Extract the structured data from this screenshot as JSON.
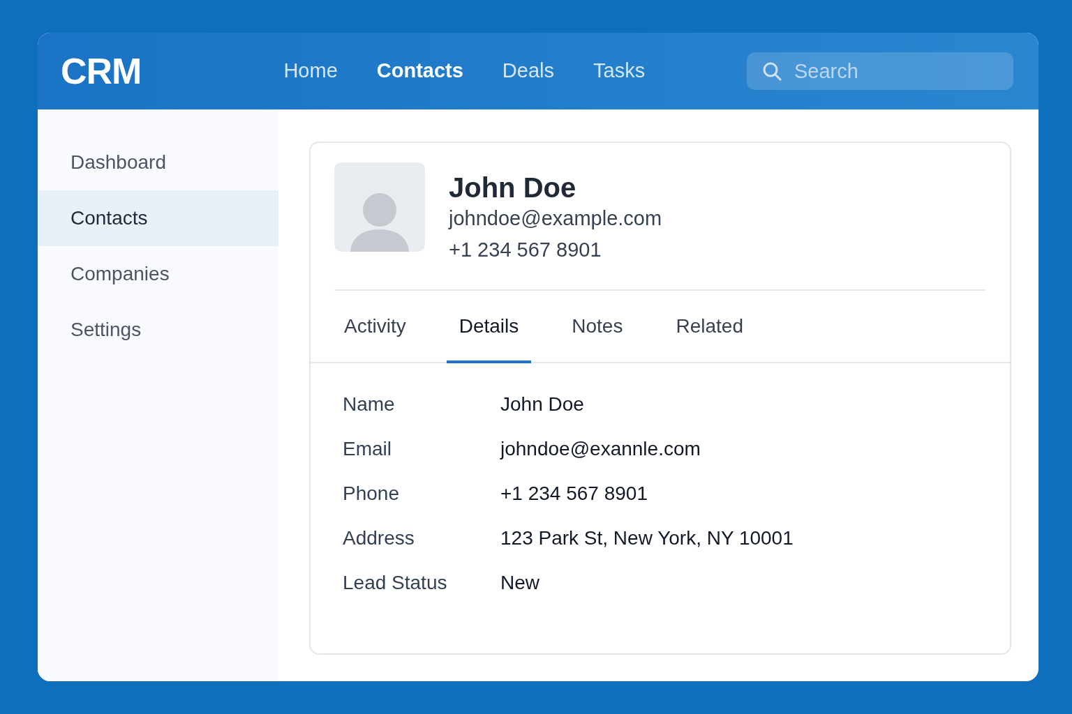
{
  "header": {
    "logo": "CRM",
    "nav": [
      {
        "label": "Home",
        "selected": false
      },
      {
        "label": "Contacts",
        "selected": true
      },
      {
        "label": "Deals",
        "selected": false
      },
      {
        "label": "Tasks",
        "selected": false
      }
    ],
    "search": {
      "placeholder": "Search"
    }
  },
  "sidebar": {
    "items": [
      {
        "label": "Dashboard",
        "selected": false
      },
      {
        "label": "Contacts",
        "selected": true
      },
      {
        "label": "Companies",
        "selected": false
      },
      {
        "label": "Settings",
        "selected": false
      }
    ]
  },
  "contact": {
    "name": "John Doe",
    "email": "johndoe@example.com",
    "phone": "+1 234 567 8901"
  },
  "tabs": [
    {
      "label": "Activity",
      "selected": false
    },
    {
      "label": "Details",
      "selected": true
    },
    {
      "label": "Notes",
      "selected": false
    },
    {
      "label": "Related",
      "selected": false
    }
  ],
  "details": [
    {
      "label": "Name",
      "value": "John Doe"
    },
    {
      "label": "Email",
      "value": "johndoe@exannle.com"
    },
    {
      "label": "Phone",
      "value": "+1 234 567 8901"
    },
    {
      "label": "Address",
      "value": "123 Park St, New York, NY 10001"
    },
    {
      "label": "Lead Status",
      "value": "New"
    }
  ]
}
